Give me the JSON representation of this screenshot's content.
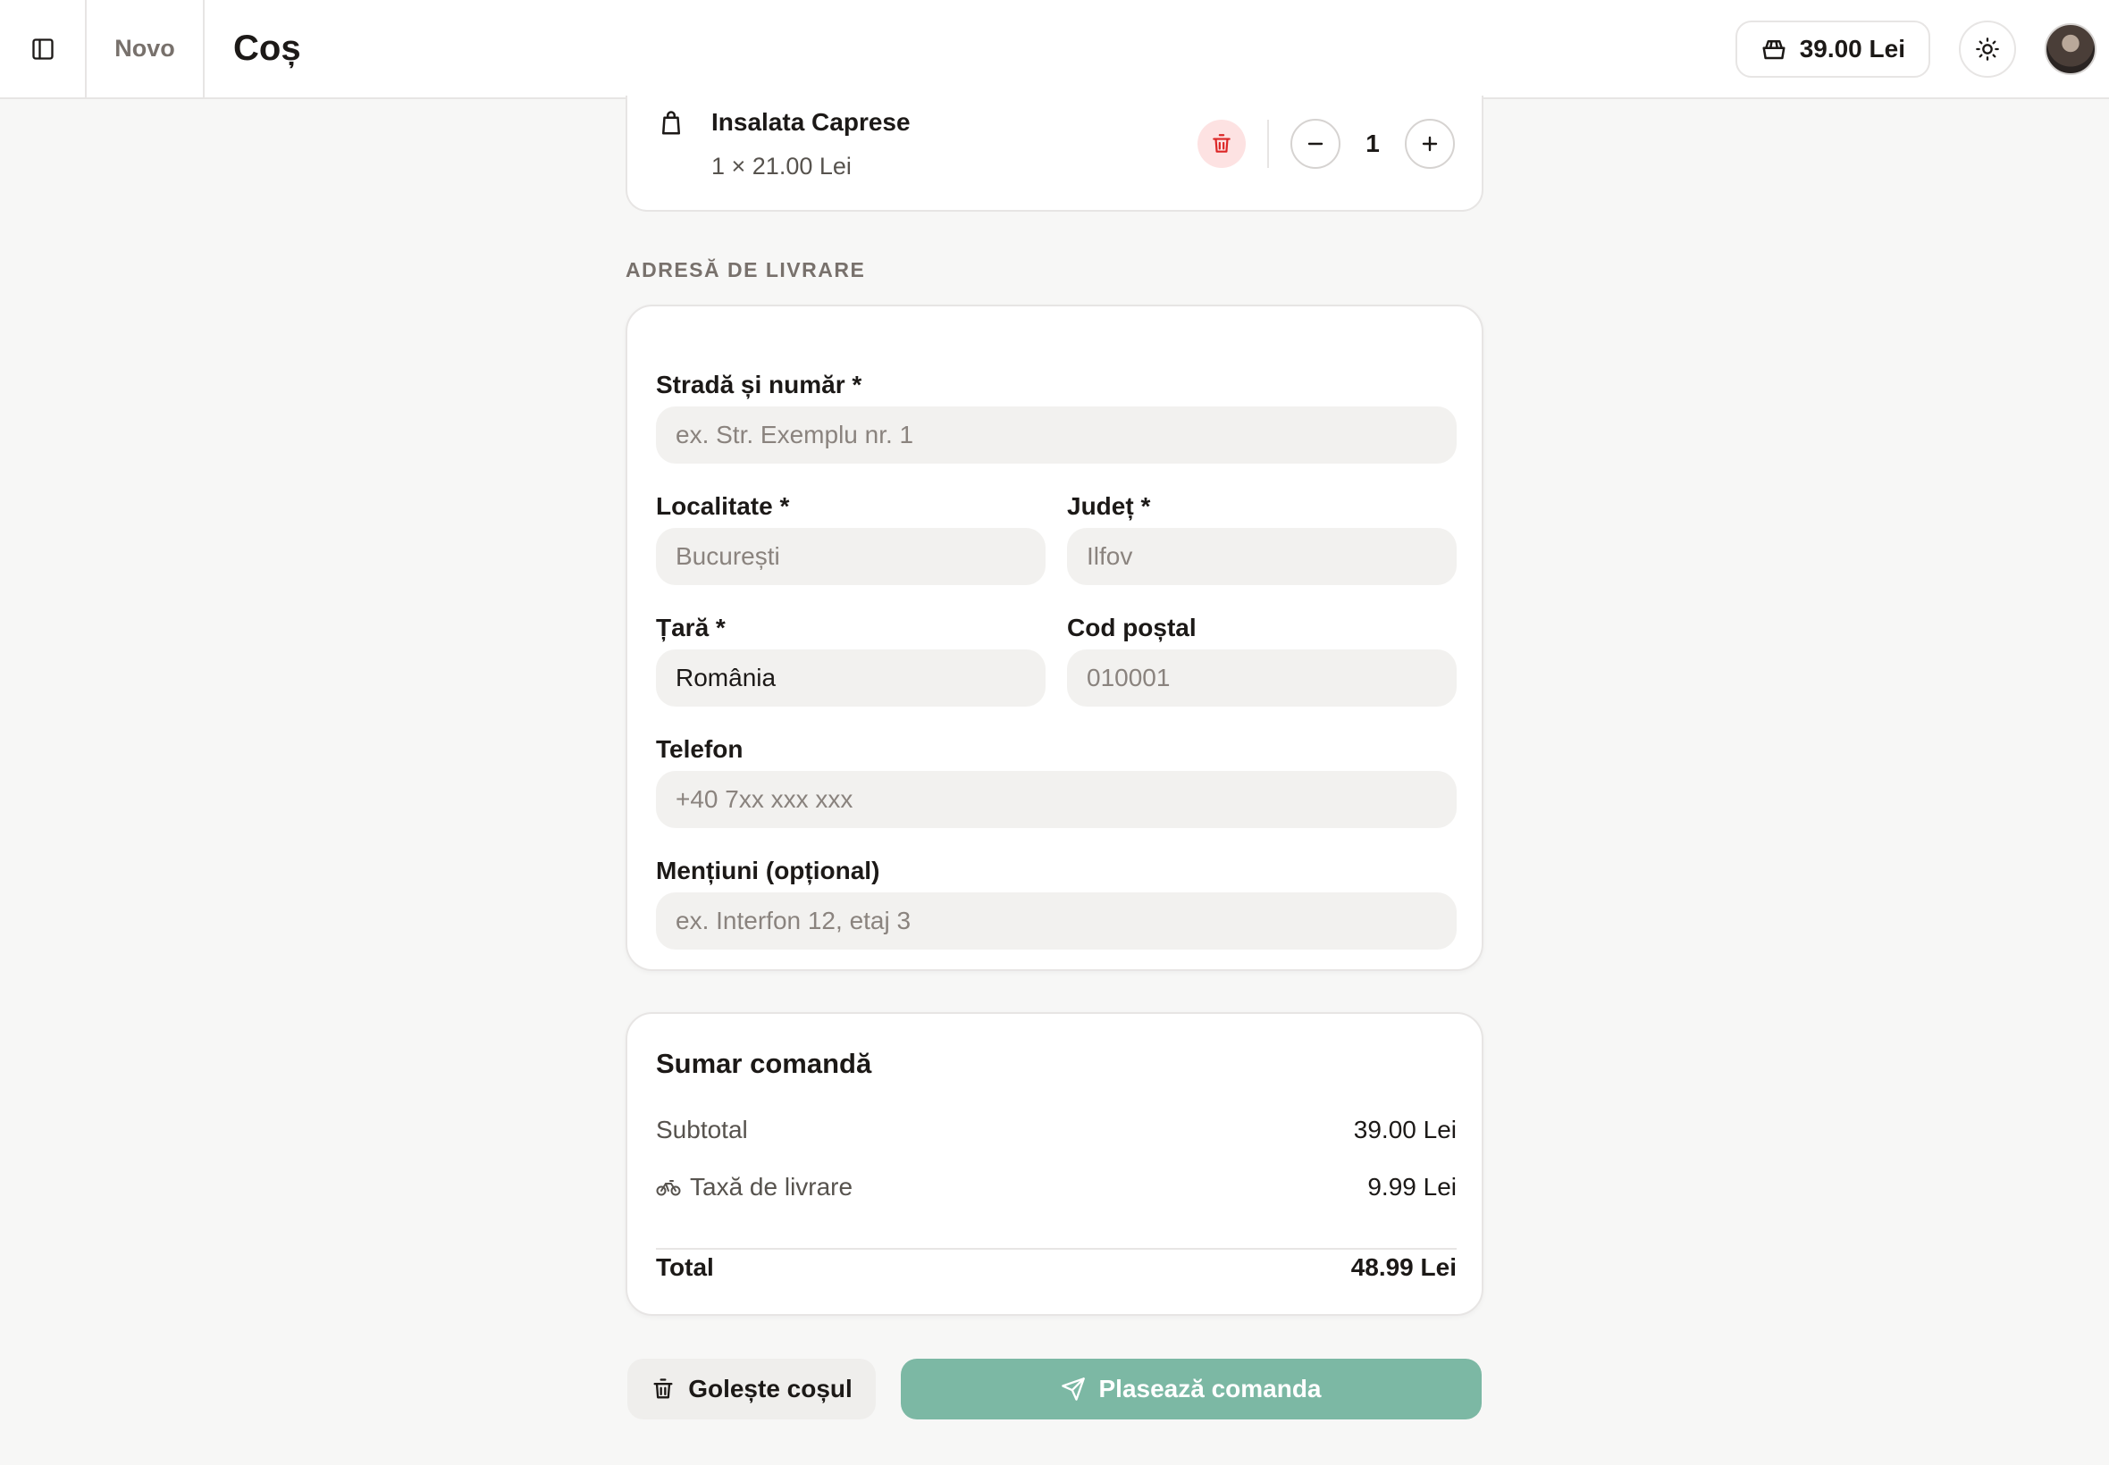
{
  "header": {
    "brand": "Novo",
    "title": "Coș",
    "cart_total": "39.00 Lei"
  },
  "cart_item": {
    "name": "Insalata Caprese",
    "unit_line": "1 × 21.00 Lei",
    "quantity": "1"
  },
  "address": {
    "section_label": "Adresă de livrare",
    "street": {
      "label": "Stradă și număr *",
      "placeholder": "ex. Str. Exemplu nr. 1",
      "value": ""
    },
    "city": {
      "label": "Localitate *",
      "placeholder": "București",
      "value": ""
    },
    "county": {
      "label": "Județ *",
      "placeholder": "Ilfov",
      "value": ""
    },
    "country": {
      "label": "Țară *",
      "placeholder": "",
      "value": "România"
    },
    "postal": {
      "label": "Cod poștal",
      "placeholder": "010001",
      "value": ""
    },
    "phone": {
      "label": "Telefon",
      "placeholder": "+40 7xx xxx xxx",
      "value": ""
    },
    "notes": {
      "label": "Mențiuni (opțional)",
      "placeholder": "ex. Interfon 12, etaj 3",
      "value": ""
    }
  },
  "summary": {
    "title": "Sumar comandă",
    "subtotal_label": "Subtotal",
    "subtotal_value": "39.00 Lei",
    "delivery_label": "Taxă de livrare",
    "delivery_value": "9.99 Lei",
    "total_label": "Total",
    "total_value": "48.99 Lei"
  },
  "actions": {
    "clear_label": "Golește coșul",
    "place_label": "Plasează comanda"
  },
  "colors": {
    "accent": "#7cb8a4",
    "danger": "#dc2626",
    "danger_bg": "#fde2e2"
  }
}
